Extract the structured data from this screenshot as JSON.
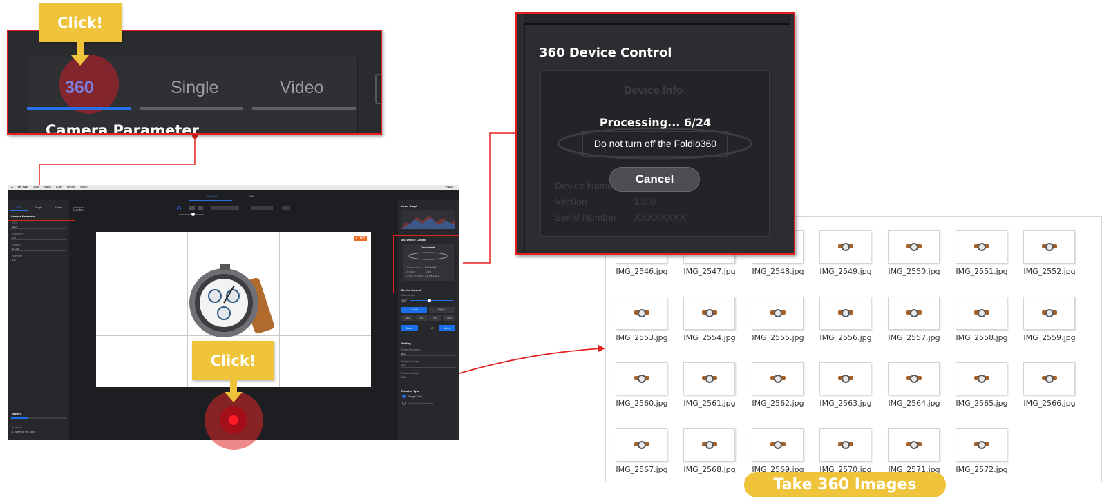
{
  "callouts": {
    "top": "Click!",
    "bottom": "Click!"
  },
  "zoom_tabs": {
    "t360": "360",
    "single": "Single",
    "video": "Video",
    "heading": "Camera Parameter"
  },
  "app": {
    "menu": [
      "PC360",
      "File",
      "View",
      "Edit",
      "Mode",
      "Help"
    ],
    "status": "84%",
    "top_tabs": {
      "capture": "Capture",
      "edit": "Edit"
    },
    "left_tabs": {
      "t360": "360",
      "single": "Single",
      "video": "Video",
      "dropdown": "Auto"
    },
    "camera_parameter": "Camera Parameter",
    "params": [
      {
        "label": "ISO",
        "value": "640"
      },
      {
        "label": "Exposure",
        "value": "0.0"
      },
      {
        "label": "Shutter",
        "value": "1/125"
      },
      {
        "label": "Aperture",
        "value": "5.6"
      }
    ],
    "battery": "Battery",
    "transfer_label": "Transfer",
    "transfer_value": "1. Save to PC only",
    "live": "LIVE",
    "right": {
      "level_graph": "Level Graph",
      "device_control_360": "360 Device Control",
      "device_info": "Device Info",
      "info_rows": [
        {
          "k": "Device Name",
          "v": "Foldio360"
        },
        {
          "k": "Version",
          "v": "1.0.0"
        },
        {
          "k": "Serial Number",
          "v": "XXXXXXXX"
        }
      ],
      "device_control": "Device Control",
      "start_angle": "Start Angle",
      "angle_value": "180°",
      "left_btn": "< Left",
      "right_btn": "Right >",
      "steps": [
        "-360°",
        "-90°",
        "+90°",
        "+360°"
      ],
      "move": "Move",
      "move_value": "0°",
      "setting": "Setting",
      "settings": [
        {
          "label": "Frame Number",
          "value": "6/8"
        },
        {
          "label": "Rotation Angle",
          "value": "0.0"
        },
        {
          "label": "Rotation Angle",
          "value": "0.0"
        }
      ],
      "rotation_type": "Rotation Type",
      "single_turn": "Single Turn",
      "continuous": "Continuous Rotation"
    }
  },
  "dialog": {
    "title": "360 Device Control",
    "device_info": "Device Info",
    "processing": "Processing... 6/24",
    "warning": "Do not turn off the Foldio360",
    "cancel": "Cancel",
    "rows": [
      {
        "k": "Device Name",
        "v": ""
      },
      {
        "k": "Version",
        "v": "1.0.0"
      },
      {
        "k": "Serial Number",
        "v": "XXXXXXXX"
      }
    ]
  },
  "files": [
    "IMG_2546.jpg",
    "IMG_2547.jpg",
    "IMG_2548.jpg",
    "IMG_2549.jpg",
    "IMG_2550.jpg",
    "IMG_2551.jpg",
    "IMG_2552.jpg",
    "IMG_2553.jpg",
    "IMG_2554.jpg",
    "IMG_2555.jpg",
    "IMG_2556.jpg",
    "IMG_2557.jpg",
    "IMG_2558.jpg",
    "IMG_2559.jpg",
    "IMG_2560.jpg",
    "IMG_2561.jpg",
    "IMG_2562.jpg",
    "IMG_2563.jpg",
    "IMG_2564.jpg",
    "IMG_2565.jpg",
    "IMG_2566.jpg",
    "IMG_2567.jpg",
    "IMG_2568.jpg",
    "IMG_2569.jpg",
    "IMG_2570.jpg",
    "IMG_2571.jpg",
    "IMG_2572.jpg"
  ],
  "banner": "Take 360 Images",
  "colors": {
    "accent_red": "#e32020",
    "callout_yellow": "#efc43a",
    "blue": "#1b6fe8"
  }
}
